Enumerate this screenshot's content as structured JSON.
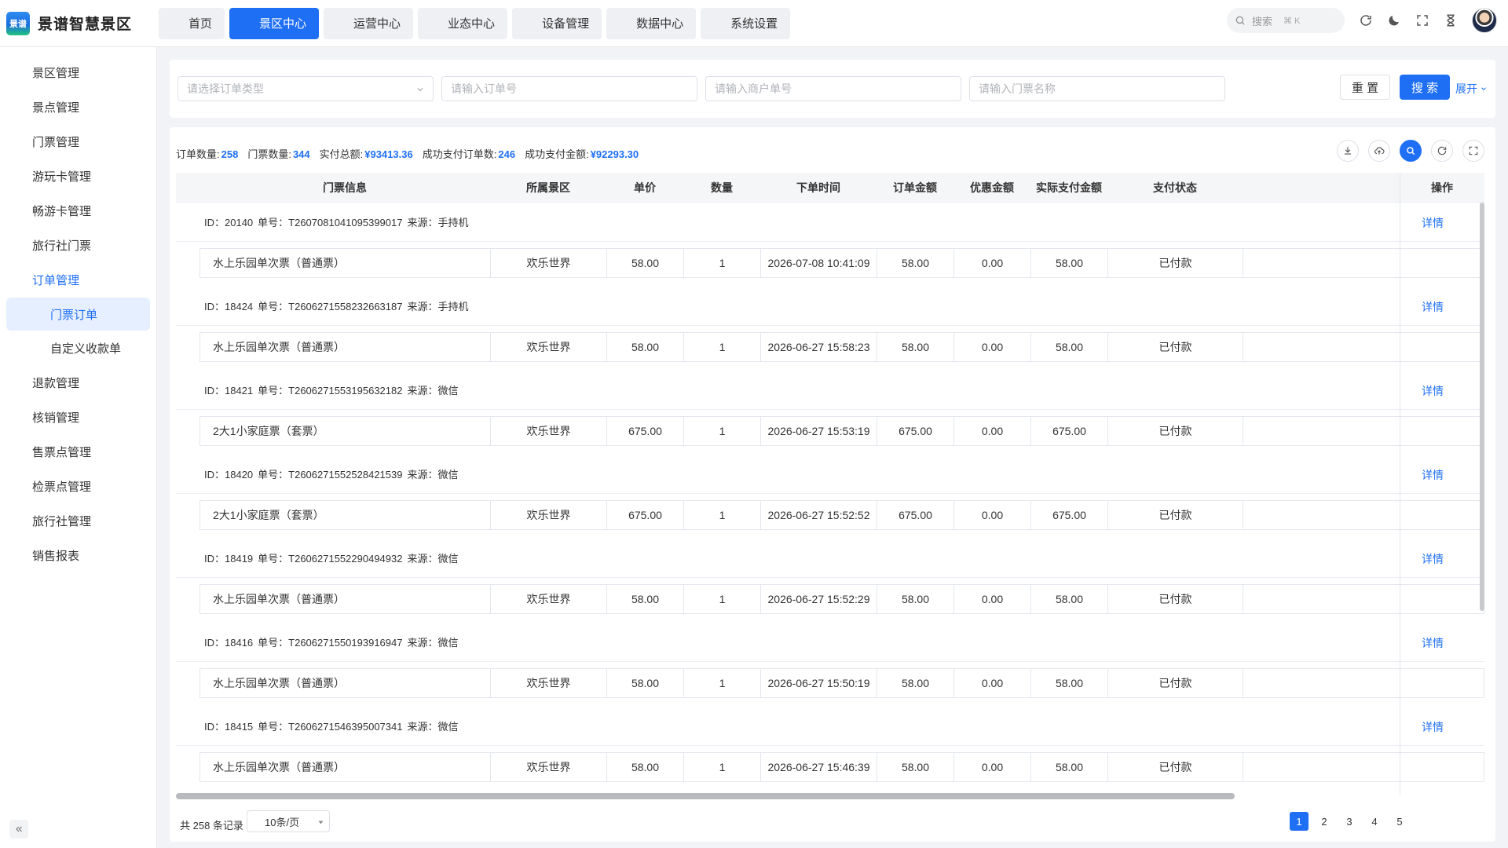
{
  "app": {
    "logo_badge": "景谱",
    "title": "景谱智慧景区"
  },
  "nav": [
    {
      "label": "首页",
      "icon": "home-icon",
      "active": false
    },
    {
      "label": "景区中心",
      "icon": "scenic-icon",
      "active": true
    },
    {
      "label": "运营中心",
      "icon": "operations-icon",
      "active": false
    },
    {
      "label": "业态中心",
      "icon": "business-icon",
      "active": false
    },
    {
      "label": "设备管理",
      "icon": "device-icon",
      "active": false
    },
    {
      "label": "数据中心",
      "icon": "data-icon",
      "active": false
    },
    {
      "label": "系统设置",
      "icon": "gear-icon",
      "active": false
    }
  ],
  "header_search": {
    "placeholder": "搜索",
    "shortcut": "⌘ K"
  },
  "sidebar": {
    "items": [
      {
        "label": "景区管理",
        "icon": "cube-icon"
      },
      {
        "label": "景点管理",
        "icon": "building-icon"
      },
      {
        "label": "门票管理",
        "icon": "ticket-icon",
        "has_children": true
      },
      {
        "label": "游玩卡管理",
        "icon": "card-icon",
        "has_children": true
      },
      {
        "label": "畅游卡管理",
        "icon": "id-card-icon",
        "has_children": true
      },
      {
        "label": "旅行社门票",
        "icon": "ticket-alt-icon",
        "has_children": true
      },
      {
        "label": "订单管理",
        "icon": "order-icon",
        "has_children": true,
        "open": true
      },
      {
        "label": "退款管理",
        "icon": "refund-icon",
        "has_children": true
      },
      {
        "label": "核销管理",
        "icon": "verify-icon",
        "has_children": true
      },
      {
        "label": "售票点管理",
        "icon": "pos-icon"
      },
      {
        "label": "检票点管理",
        "icon": "gate-icon"
      },
      {
        "label": "旅行社管理",
        "icon": "globe-icon",
        "has_children": true
      },
      {
        "label": "销售报表",
        "icon": "report-icon"
      }
    ],
    "sub_items": [
      {
        "label": "门票订单",
        "active": true
      },
      {
        "label": "自定义收款单",
        "active": false
      }
    ]
  },
  "filters": {
    "order_type_placeholder": "请选择订单类型",
    "order_no_placeholder": "请输入订单号",
    "merchant_no_placeholder": "请输入商户单号",
    "ticket_name_placeholder": "请输入门票名称",
    "reset_label": "重 置",
    "search_label": "搜 索",
    "expand_label": "展开"
  },
  "stats": [
    {
      "label": "订单数量:",
      "value": "258"
    },
    {
      "label": "门票数量:",
      "value": "344"
    },
    {
      "label": "实付总额:",
      "value": "¥93413.36"
    },
    {
      "label": "成功支付订单数:",
      "value": "246"
    },
    {
      "label": "成功支付金额:",
      "value": "¥92293.30"
    }
  ],
  "table": {
    "columns": [
      "门票信息",
      "所属景区",
      "单价",
      "数量",
      "下单时间",
      "订单金额",
      "优惠金额",
      "实际支付金额",
      "支付状态",
      "操作"
    ],
    "detail_label": "详情",
    "groups": [
      {
        "id": "ID：20140",
        "no": "单号：T2607081041095399017",
        "source": "来源：手持机",
        "row": [
          "水上乐园单次票（普通票）",
          "欢乐世界",
          "58.00",
          "1",
          "2026-07-08 10:41:09",
          "58.00",
          "0.00",
          "58.00",
          "已付款"
        ]
      },
      {
        "id": "ID：18424",
        "no": "单号：T2606271558232663187",
        "source": "来源：手持机",
        "row": [
          "水上乐园单次票（普通票）",
          "欢乐世界",
          "58.00",
          "1",
          "2026-06-27 15:58:23",
          "58.00",
          "0.00",
          "58.00",
          "已付款"
        ]
      },
      {
        "id": "ID：18421",
        "no": "单号：T2606271553195632182",
        "source": "来源：微信",
        "row": [
          "2大1小家庭票（套票）",
          "欢乐世界",
          "675.00",
          "1",
          "2026-06-27 15:53:19",
          "675.00",
          "0.00",
          "675.00",
          "已付款"
        ]
      },
      {
        "id": "ID：18420",
        "no": "单号：T2606271552528421539",
        "source": "来源：微信",
        "row": [
          "2大1小家庭票（套票）",
          "欢乐世界",
          "675.00",
          "1",
          "2026-06-27 15:52:52",
          "675.00",
          "0.00",
          "675.00",
          "已付款"
        ]
      },
      {
        "id": "ID：18419",
        "no": "单号：T2606271552290494932",
        "source": "来源：微信",
        "row": [
          "水上乐园单次票（普通票）",
          "欢乐世界",
          "58.00",
          "1",
          "2026-06-27 15:52:29",
          "58.00",
          "0.00",
          "58.00",
          "已付款"
        ]
      },
      {
        "id": "ID：18416",
        "no": "单号：T2606271550193916947",
        "source": "来源：微信",
        "row": [
          "水上乐园单次票（普通票）",
          "欢乐世界",
          "58.00",
          "1",
          "2026-06-27 15:50:19",
          "58.00",
          "0.00",
          "58.00",
          "已付款"
        ]
      },
      {
        "id": "ID：18415",
        "no": "单号：T2606271546395007341",
        "source": "来源：微信",
        "row": [
          "水上乐园单次票（普通票）",
          "欢乐世界",
          "58.00",
          "1",
          "2026-06-27 15:46:39",
          "58.00",
          "0.00",
          "58.00",
          "已付款"
        ]
      }
    ]
  },
  "pagination": {
    "total": "共 258 条记录",
    "page_size": "10条/页",
    "pages": [
      "1",
      "2",
      "3",
      "4",
      "5"
    ],
    "current": "1"
  },
  "colors": {
    "primary": "#1f6ff5",
    "active_bg": "#e6efff"
  }
}
